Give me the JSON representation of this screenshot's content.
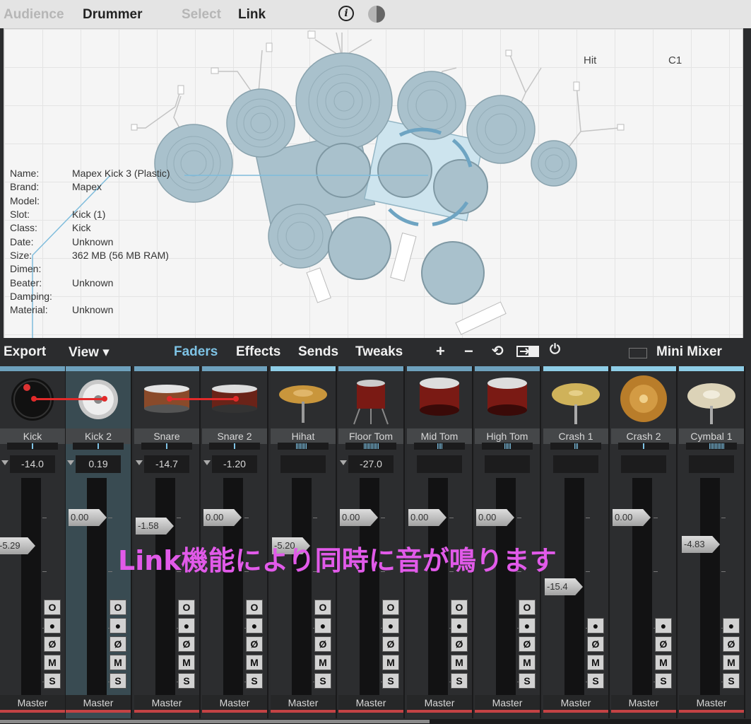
{
  "top_tabs": [
    {
      "label": "Audience",
      "state": "dim"
    },
    {
      "label": "Drummer",
      "state": "on"
    },
    {
      "label": "Select",
      "state": "dim"
    },
    {
      "label": "Link",
      "state": "on"
    }
  ],
  "icons": {
    "info": "i",
    "theme": "half-circle-icon"
  },
  "viewport": {
    "hit_header": "Hit",
    "note_header": "C1",
    "info_keys": [
      "Name:",
      "Brand:",
      "Model:",
      "Slot:",
      "Class:",
      "Date:",
      "Size:",
      "Dimen:",
      "Beater:",
      "Damping:",
      "Material:"
    ],
    "info_values": [
      "Mapex Kick 3 (Plastic)",
      "Mapex",
      "",
      "Kick (1)",
      "Kick",
      "Unknown",
      "362 MB (56 MB RAM)",
      "",
      "Unknown",
      "",
      "Unknown"
    ]
  },
  "toolbar": {
    "export": "Export",
    "view": "View ▾",
    "tabs": [
      "Faders",
      "Effects",
      "Sends",
      "Tweaks"
    ],
    "active_tab": "Faders",
    "plus": "+",
    "minus": "−",
    "refresh": "⟲",
    "power": "⏻",
    "mini_mixer": "Mini Mixer"
  },
  "channels": [
    {
      "name": "Kick",
      "gain": "-14.0",
      "fader": "-5.29",
      "has_o": true,
      "type": "kick1",
      "output": "Master"
    },
    {
      "name": "Kick 2",
      "gain": "0.19",
      "fader": "0.00",
      "has_o": true,
      "type": "kick2",
      "output": "Master",
      "selected": true
    },
    {
      "name": "Snare",
      "gain": "-14.7",
      "fader": "-1.58",
      "has_o": true,
      "type": "snare",
      "output": "Master"
    },
    {
      "name": "Snare 2",
      "gain": "-1.20",
      "fader": "0.00",
      "has_o": true,
      "type": "snare2",
      "output": "Master"
    },
    {
      "name": "Hihat",
      "gain": "",
      "fader": "-5.20",
      "has_o": true,
      "type": "hihat",
      "output": "Master"
    },
    {
      "name": "Floor Tom",
      "gain": "-27.0",
      "fader": "0.00",
      "has_o": true,
      "type": "floortom",
      "output": "Master"
    },
    {
      "name": "Mid Tom",
      "gain": "",
      "fader": "0.00",
      "has_o": true,
      "type": "tom",
      "output": "Master"
    },
    {
      "name": "High Tom",
      "gain": "",
      "fader": "0.00",
      "has_o": true,
      "type": "tom",
      "output": "Master"
    },
    {
      "name": "Crash 1",
      "gain": "",
      "fader": "-15.4",
      "has_o": false,
      "type": "crash",
      "output": "Master"
    },
    {
      "name": "Crash 2",
      "gain": "",
      "fader": "0.00",
      "has_o": false,
      "type": "crash2",
      "output": "Master"
    },
    {
      "name": "Cymbal 1",
      "gain": "",
      "fader": "-4.83",
      "has_o": false,
      "type": "cymbal",
      "output": "Master"
    }
  ],
  "button_labels": {
    "o": "O",
    "rec": "●",
    "phase": "Ø",
    "mute": "M",
    "solo": "S"
  },
  "overlay_caption": "Link機能により同時に音が鳴ります",
  "colors": {
    "accent": "#7ec3e5",
    "link": "#e12a2a",
    "caption": "#e15ae9",
    "drum": "#a9c1cc"
  }
}
